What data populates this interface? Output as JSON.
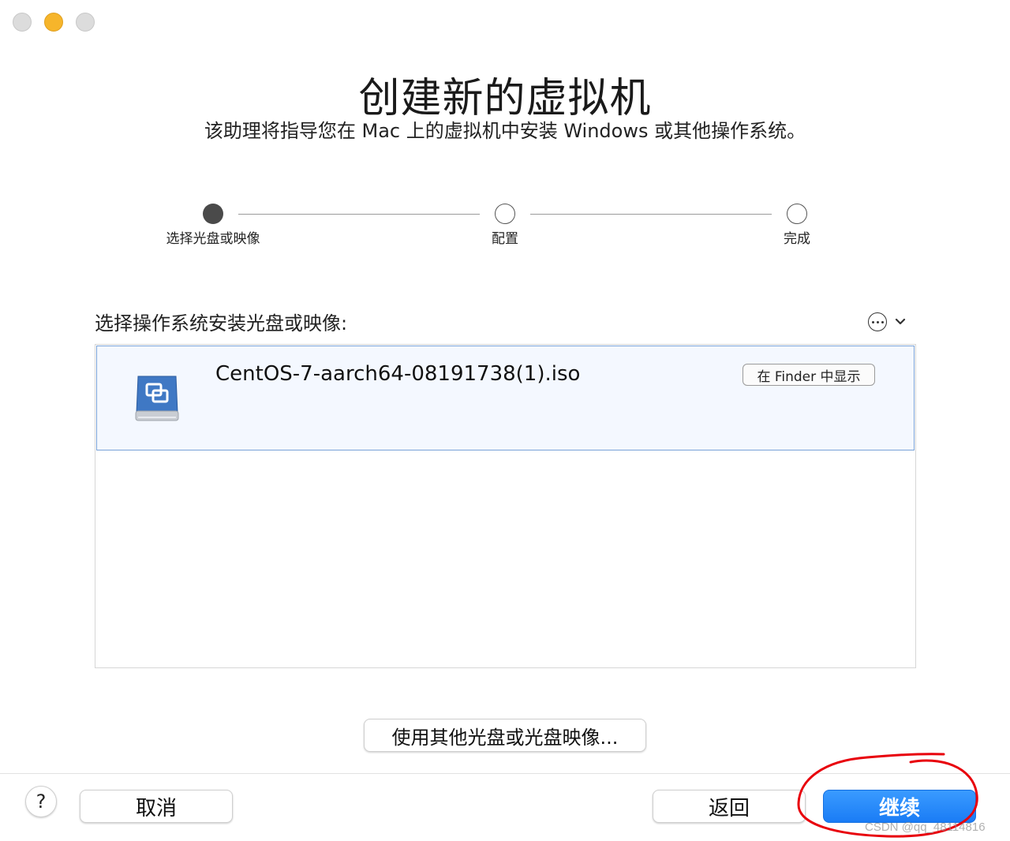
{
  "window": {
    "title": "创建新的虚拟机",
    "subtitle": "该助理将指导您在 Mac 上的虚拟机中安装 Windows 或其他操作系统。"
  },
  "steps": [
    {
      "label": "选择光盘或映像",
      "state": "active"
    },
    {
      "label": "配置",
      "state": "inactive"
    },
    {
      "label": "完成",
      "state": "inactive"
    }
  ],
  "section": {
    "label": "选择操作系统安装光盘或映像:",
    "more_icon": "ellipsis-circle-icon"
  },
  "list": {
    "items": [
      {
        "name": "CentOS-7-aarch64-08191738(1).iso",
        "icon": "disk-image-icon",
        "action_label": "在 Finder 中显示",
        "selected": true
      }
    ]
  },
  "other_disc_button": "使用其他光盘或光盘映像...",
  "footer": {
    "help_label": "?",
    "cancel_label": "取消",
    "back_label": "返回",
    "continue_label": "继续"
  },
  "watermark": "CSDN @qq_48114816",
  "colors": {
    "primary": "#1a7cf5",
    "selection_bg": "#f4f8ff",
    "annotation": "#e8000b"
  }
}
